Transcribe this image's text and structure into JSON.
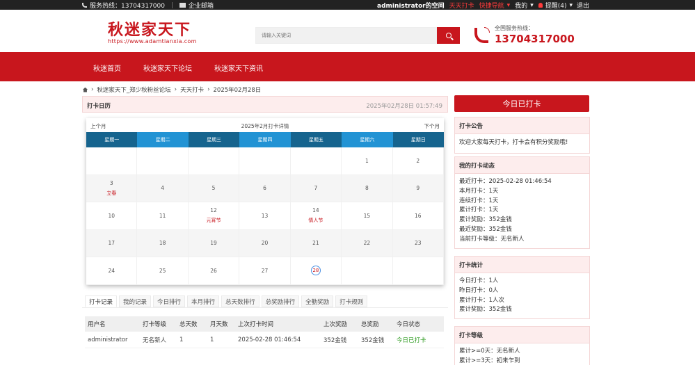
{
  "topbar": {
    "hotline": "服务热线：13704317000",
    "mail": "企业邮箱",
    "space": "administrator的空间",
    "daily_checkin": "天天打卡",
    "quick_nav": "快捷导航",
    "mine": "我的",
    "remind": "提醒(4)",
    "logout": "退出"
  },
  "header": {
    "logo_name": "秋迷家天下",
    "logo_url": "https://www.adamtianxia.com",
    "search_placeholder": "请输入关键词",
    "hotline_label": "全国服务热线：",
    "hotline_number": "13704317000"
  },
  "nav": [
    "秋迷首页",
    "秋迷家天下论坛",
    "秋迷家天下资讯"
  ],
  "breadcrumb": [
    "秋迷家天下_郑少秋粉丝论坛",
    "天天打卡",
    "2025年02月28日"
  ],
  "calendar": {
    "title": "打卡日历",
    "datetime": "2025年02月28日 01:57:49",
    "prev": "上个月",
    "month_label": "2025年2月打卡详情",
    "next": "下个月",
    "weekdays": [
      "星期一",
      "星期二",
      "星期三",
      "星期四",
      "星期五",
      "星期六",
      "星期日"
    ],
    "rows": [
      [
        {
          "d": ""
        },
        {
          "d": ""
        },
        {
          "d": ""
        },
        {
          "d": ""
        },
        {
          "d": ""
        },
        {
          "d": "1"
        },
        {
          "d": "2"
        }
      ],
      [
        {
          "d": "3",
          "f": "立春"
        },
        {
          "d": "4"
        },
        {
          "d": "5"
        },
        {
          "d": "6"
        },
        {
          "d": "7"
        },
        {
          "d": "8"
        },
        {
          "d": "9"
        }
      ],
      [
        {
          "d": "10"
        },
        {
          "d": "11"
        },
        {
          "d": "12",
          "f": "元宵节"
        },
        {
          "d": "13"
        },
        {
          "d": "14",
          "f": "情人节"
        },
        {
          "d": "15"
        },
        {
          "d": "16"
        }
      ],
      [
        {
          "d": "17"
        },
        {
          "d": "18"
        },
        {
          "d": "19"
        },
        {
          "d": "20"
        },
        {
          "d": "21"
        },
        {
          "d": "22"
        },
        {
          "d": "23"
        }
      ],
      [
        {
          "d": "24"
        },
        {
          "d": "25"
        },
        {
          "d": "26"
        },
        {
          "d": "27"
        },
        {
          "d": "28",
          "today": true
        },
        {
          "d": ""
        },
        {
          "d": ""
        }
      ]
    ]
  },
  "tabs": [
    "打卡记录",
    "我的记录",
    "今日排行",
    "本月排行",
    "总天数排行",
    "总奖励排行",
    "全勤奖励",
    "打卡规则"
  ],
  "records": {
    "headers": [
      "用户名",
      "打卡等级",
      "总天数",
      "月天数",
      "上次打卡时间",
      "上次奖励",
      "总奖励",
      "今日状态"
    ],
    "rows": [
      [
        "administrator",
        "无名新人",
        "1",
        "1",
        "2025-02-28 01:46:54",
        "352金钱",
        "352金钱",
        "今日已打卡"
      ]
    ]
  },
  "sidebar": {
    "checkin_button": "今日已打卡",
    "notice_title": "打卡公告",
    "notice_text": "欢迎大家每天打卡，打卡会有积分奖励哦!",
    "my_title": "我的打卡动态",
    "my_lines": [
      "最近打卡：2025-02-28 01:46:54",
      "本月打卡：1天",
      "连续打卡：1天",
      "累计打卡：1天",
      "累计奖励：352金钱",
      "最近奖励：352金钱",
      "当前打卡等级：无名新人"
    ],
    "stats_title": "打卡统计",
    "stats_lines": [
      "今日打卡：1人",
      "昨日打卡：0人",
      "累计打卡：1人次",
      "累计奖励：352金钱"
    ],
    "level_title": "打卡等级",
    "level_lines": [
      "累计>=0天：无名新人",
      "累计>=3天：初来乍到"
    ]
  }
}
